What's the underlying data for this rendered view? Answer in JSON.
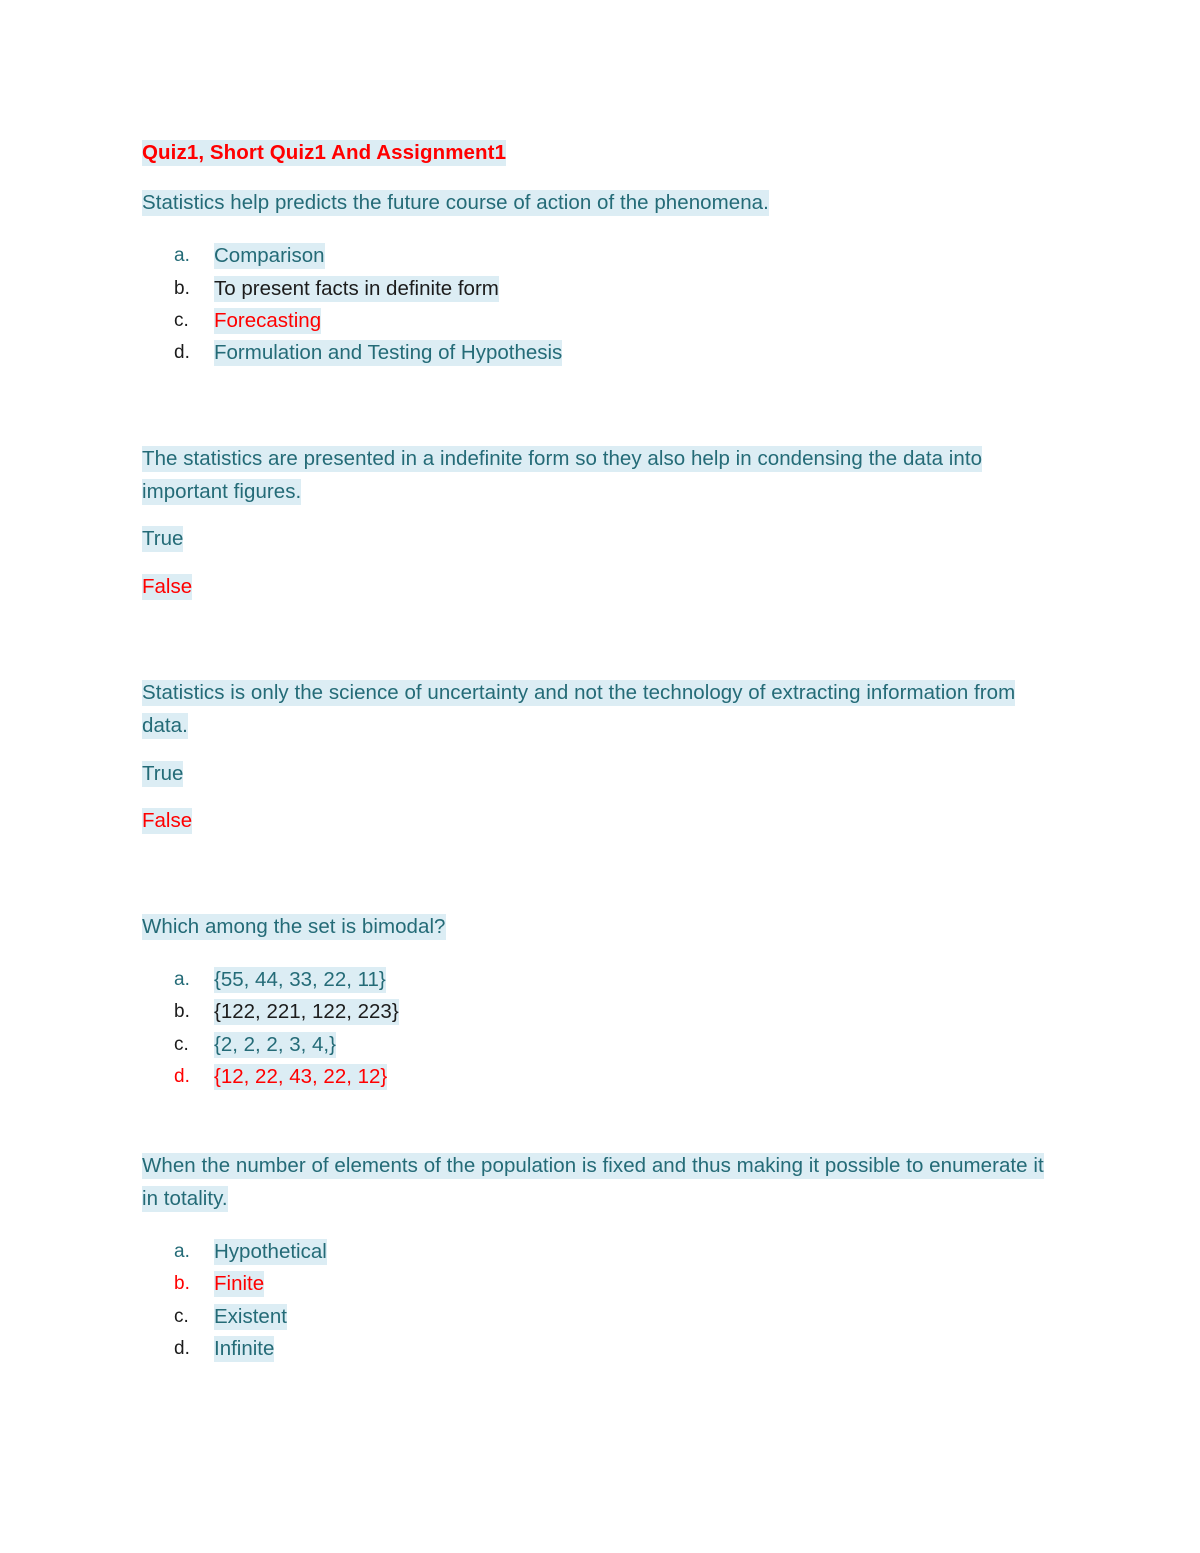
{
  "document": {
    "title": "Quiz1, Short Quiz1 And Assignment1"
  },
  "questions": [
    {
      "id": "q1",
      "prompt": "Statistics help predicts the future course of action of the phenomena.",
      "type": "multiple-choice",
      "options": [
        {
          "marker": "a.",
          "text": "Comparison",
          "marker_color": "teal",
          "text_color": "teal"
        },
        {
          "marker": "b.",
          "text": "To present facts in definite form",
          "marker_color": "dark",
          "text_color": "dark"
        },
        {
          "marker": "c.",
          "text": " Forecasting",
          "marker_color": "dark",
          "text_color": "red"
        },
        {
          "marker": "d.",
          "text": " Formulation and Testing of Hypothesis",
          "marker_color": "dark",
          "text_color": "teal"
        }
      ]
    },
    {
      "id": "q2",
      "prompt": "The statistics are presented in a indefinite form so they also help in condensing the data into important figures.",
      "type": "true-false",
      "options": [
        {
          "text": "True",
          "text_color": "teal"
        },
        {
          "text": "False",
          "text_color": "red"
        }
      ]
    },
    {
      "id": "q3",
      "prompt": "Statistics is only the science of uncertainty and not the technology of extracting information from data.",
      "type": "true-false",
      "options": [
        {
          "text": "True",
          "text_color": "teal"
        },
        {
          "text": "False",
          "text_color": "red"
        }
      ]
    },
    {
      "id": "q4",
      "prompt": "Which among the set is bimodal?",
      "type": "multiple-choice",
      "options": [
        {
          "marker": "a.",
          "text": "{55, 44, 33, 22, 11}",
          "marker_color": "teal",
          "text_color": "teal"
        },
        {
          "marker": "b.",
          "text": "{122, 221, 122, 223}",
          "marker_color": "dark",
          "text_color": "dark"
        },
        {
          "marker": "c.",
          "text": "{2, 2, 2, 3, 4,}",
          "marker_color": "dark",
          "text_color": "teal"
        },
        {
          "marker": "d.",
          "text": "{12, 22, 43, 22, 12}",
          "marker_color": "red",
          "text_color": "red"
        }
      ]
    },
    {
      "id": "q5",
      "prompt": "When the number of elements of the population is fixed and thus making it possible to enumerate it in totality.",
      "type": "multiple-choice",
      "options": [
        {
          "marker": "a.",
          "text": "Hypothetical",
          "marker_color": "teal",
          "text_color": "teal"
        },
        {
          "marker": "b.",
          "text": "Finite",
          "marker_color": "red",
          "text_color": "red"
        },
        {
          "marker": "c.",
          "text": "Existent",
          "marker_color": "dark",
          "text_color": "teal"
        },
        {
          "marker": "d.",
          "text": "Infinite",
          "marker_color": "dark",
          "text_color": "teal"
        }
      ]
    }
  ],
  "colors": {
    "highlight": "#dcedf4",
    "teal": "#246b77",
    "red": "#ff0000",
    "dark": "#1c1c1c",
    "page_background": "#ffffff"
  }
}
